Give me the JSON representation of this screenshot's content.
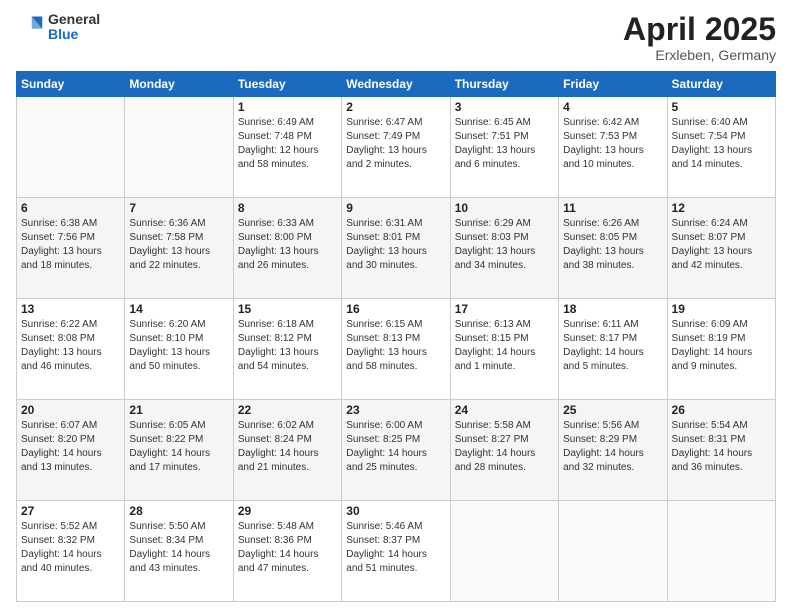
{
  "logo": {
    "general": "General",
    "blue": "Blue"
  },
  "header": {
    "month": "April 2025",
    "location": "Erxleben, Germany"
  },
  "weekdays": [
    "Sunday",
    "Monday",
    "Tuesday",
    "Wednesday",
    "Thursday",
    "Friday",
    "Saturday"
  ],
  "weeks": [
    [
      {
        "day": "",
        "info": ""
      },
      {
        "day": "",
        "info": ""
      },
      {
        "day": "1",
        "info": "Sunrise: 6:49 AM\nSunset: 7:48 PM\nDaylight: 12 hours and 58 minutes."
      },
      {
        "day": "2",
        "info": "Sunrise: 6:47 AM\nSunset: 7:49 PM\nDaylight: 13 hours and 2 minutes."
      },
      {
        "day": "3",
        "info": "Sunrise: 6:45 AM\nSunset: 7:51 PM\nDaylight: 13 hours and 6 minutes."
      },
      {
        "day": "4",
        "info": "Sunrise: 6:42 AM\nSunset: 7:53 PM\nDaylight: 13 hours and 10 minutes."
      },
      {
        "day": "5",
        "info": "Sunrise: 6:40 AM\nSunset: 7:54 PM\nDaylight: 13 hours and 14 minutes."
      }
    ],
    [
      {
        "day": "6",
        "info": "Sunrise: 6:38 AM\nSunset: 7:56 PM\nDaylight: 13 hours and 18 minutes."
      },
      {
        "day": "7",
        "info": "Sunrise: 6:36 AM\nSunset: 7:58 PM\nDaylight: 13 hours and 22 minutes."
      },
      {
        "day": "8",
        "info": "Sunrise: 6:33 AM\nSunset: 8:00 PM\nDaylight: 13 hours and 26 minutes."
      },
      {
        "day": "9",
        "info": "Sunrise: 6:31 AM\nSunset: 8:01 PM\nDaylight: 13 hours and 30 minutes."
      },
      {
        "day": "10",
        "info": "Sunrise: 6:29 AM\nSunset: 8:03 PM\nDaylight: 13 hours and 34 minutes."
      },
      {
        "day": "11",
        "info": "Sunrise: 6:26 AM\nSunset: 8:05 PM\nDaylight: 13 hours and 38 minutes."
      },
      {
        "day": "12",
        "info": "Sunrise: 6:24 AM\nSunset: 8:07 PM\nDaylight: 13 hours and 42 minutes."
      }
    ],
    [
      {
        "day": "13",
        "info": "Sunrise: 6:22 AM\nSunset: 8:08 PM\nDaylight: 13 hours and 46 minutes."
      },
      {
        "day": "14",
        "info": "Sunrise: 6:20 AM\nSunset: 8:10 PM\nDaylight: 13 hours and 50 minutes."
      },
      {
        "day": "15",
        "info": "Sunrise: 6:18 AM\nSunset: 8:12 PM\nDaylight: 13 hours and 54 minutes."
      },
      {
        "day": "16",
        "info": "Sunrise: 6:15 AM\nSunset: 8:13 PM\nDaylight: 13 hours and 58 minutes."
      },
      {
        "day": "17",
        "info": "Sunrise: 6:13 AM\nSunset: 8:15 PM\nDaylight: 14 hours and 1 minute."
      },
      {
        "day": "18",
        "info": "Sunrise: 6:11 AM\nSunset: 8:17 PM\nDaylight: 14 hours and 5 minutes."
      },
      {
        "day": "19",
        "info": "Sunrise: 6:09 AM\nSunset: 8:19 PM\nDaylight: 14 hours and 9 minutes."
      }
    ],
    [
      {
        "day": "20",
        "info": "Sunrise: 6:07 AM\nSunset: 8:20 PM\nDaylight: 14 hours and 13 minutes."
      },
      {
        "day": "21",
        "info": "Sunrise: 6:05 AM\nSunset: 8:22 PM\nDaylight: 14 hours and 17 minutes."
      },
      {
        "day": "22",
        "info": "Sunrise: 6:02 AM\nSunset: 8:24 PM\nDaylight: 14 hours and 21 minutes."
      },
      {
        "day": "23",
        "info": "Sunrise: 6:00 AM\nSunset: 8:25 PM\nDaylight: 14 hours and 25 minutes."
      },
      {
        "day": "24",
        "info": "Sunrise: 5:58 AM\nSunset: 8:27 PM\nDaylight: 14 hours and 28 minutes."
      },
      {
        "day": "25",
        "info": "Sunrise: 5:56 AM\nSunset: 8:29 PM\nDaylight: 14 hours and 32 minutes."
      },
      {
        "day": "26",
        "info": "Sunrise: 5:54 AM\nSunset: 8:31 PM\nDaylight: 14 hours and 36 minutes."
      }
    ],
    [
      {
        "day": "27",
        "info": "Sunrise: 5:52 AM\nSunset: 8:32 PM\nDaylight: 14 hours and 40 minutes."
      },
      {
        "day": "28",
        "info": "Sunrise: 5:50 AM\nSunset: 8:34 PM\nDaylight: 14 hours and 43 minutes."
      },
      {
        "day": "29",
        "info": "Sunrise: 5:48 AM\nSunset: 8:36 PM\nDaylight: 14 hours and 47 minutes."
      },
      {
        "day": "30",
        "info": "Sunrise: 5:46 AM\nSunset: 8:37 PM\nDaylight: 14 hours and 51 minutes."
      },
      {
        "day": "",
        "info": ""
      },
      {
        "day": "",
        "info": ""
      },
      {
        "day": "",
        "info": ""
      }
    ]
  ]
}
